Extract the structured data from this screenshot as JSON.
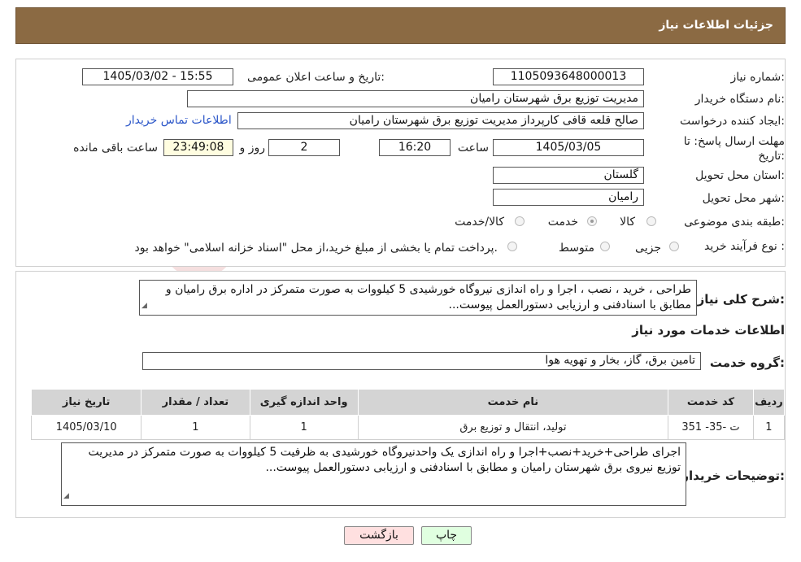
{
  "header": {
    "title": "جزئیات اطلاعات نیاز"
  },
  "fields": {
    "need_number_label": "شماره نیاز:",
    "need_number": "1105093648000013",
    "announce_label": "تاریخ و ساعت اعلان عمومی:",
    "announce_value": "1405/03/02 - 15:55",
    "buyer_org_label": "نام دستگاه خریدار:",
    "buyer_org": "مدیریت توزیع برق شهرستان رامیان",
    "creator_label": "ایجاد کننده درخواست:",
    "creator": "صالح قلعه قافی کارپرداز مدیریت توزیع برق شهرستان رامیان",
    "contact_link": "اطلاعات تماس خریدار",
    "deadline_label_1": "مهلت ارسال پاسخ: تا",
    "deadline_label_2": "تاریخ:",
    "deadline_date": "1405/03/05",
    "time_label": "ساعت",
    "deadline_time": "16:20",
    "days_value": "2",
    "days_label": "روز و",
    "remaining_time": "23:49:08",
    "remaining_label": "ساعت باقی مانده",
    "province_label": "استان محل تحویل:",
    "province": "گلستان",
    "city_label": "شهر محل تحویل:",
    "city": "رامیان",
    "category_label": "طبقه بندی موضوعی:",
    "category_options": [
      "کالا",
      "خدمت",
      "کالا/خدمت"
    ],
    "category_selected": "خدمت",
    "process_label": "نوع فرآیند خرید :",
    "process_options": [
      "جزیی",
      "متوسط"
    ],
    "process_note": "پرداخت تمام یا بخشی از مبلغ خرید،از محل \"اسناد خزانه اسلامی\" خواهد بود."
  },
  "summary": {
    "label": "شرح کلی نیاز:",
    "text": "طراحی ، خرید ، نصب ، اجرا و راه اندازی نیروگاه خورشیدی 5 کیلووات به صورت متمرکز در اداره برق رامیان و مطابق با اسنادفنی و ارزیابی دستورالعمل پیوست..."
  },
  "services": {
    "section_title": "اطلاعات خدمات مورد نیاز",
    "group_label": "گروه خدمت:",
    "group_value": "تامین برق، گاز، بخار و تهویه هوا",
    "columns": [
      "ردیف",
      "کد خدمت",
      "نام خدمت",
      "واحد اندازه گیری",
      "تعداد / مقدار",
      "تاریخ نیاز"
    ],
    "rows": [
      {
        "row": "1",
        "code": "ت -35- 351",
        "name": "تولید، انتقال و توزیع برق",
        "unit": "1",
        "qty": "1",
        "date": "1405/03/10"
      }
    ]
  },
  "buyer_notes": {
    "label": "توضیحات خریدار:",
    "text": "اجرای طراحی+خرید+نصب+اجرا و راه اندازی یک واحدنیروگاه خورشیدی به ظرفیت 5 کیلووات به صورت متمرکز در مدیریت توزیع نیروی برق شهرستان رامیان و مطابق با اسنادفنی و ارزیابی دستورالعمل پیوست..."
  },
  "buttons": {
    "print": "چاپ",
    "back": "بازگشت"
  },
  "watermark": {
    "text": "AriaTender.neT"
  },
  "colors": {
    "header_bg": "#8b6a43",
    "link": "#2a55c8",
    "table_header": "#d4d4d4",
    "back_button_bg": "#ffe0e0",
    "print_button_bg": "#e0ffe0"
  }
}
